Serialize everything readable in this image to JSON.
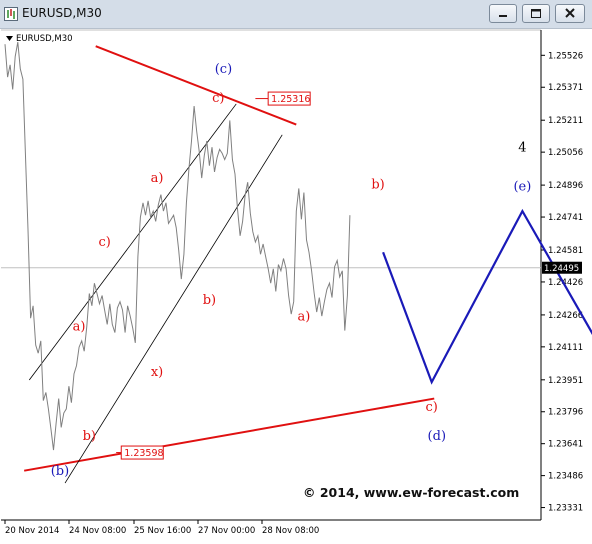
{
  "window": {
    "title": "EURUSD,M30",
    "buttons": [
      "minimize",
      "maximize",
      "close"
    ]
  },
  "colors": {
    "price": "#808080",
    "trendline": "#e01010",
    "channel": "#000000",
    "projection": "#1a1ab8",
    "label_red": "#e01010",
    "label_blue": "#1a1ab8",
    "current_price_bg": "#000000",
    "price_tag": "#e01010"
  },
  "chart_data": {
    "type": "line",
    "symbol_label": "EURUSD,M30",
    "y_ticks": [
      "1.25526",
      "1.25371",
      "1.25211",
      "1.25056",
      "1.24896",
      "1.24741",
      "1.24581",
      "1.24426",
      "1.24266",
      "1.24111",
      "1.23951",
      "1.23796",
      "1.23641",
      "1.23486",
      "1.23331"
    ],
    "y_range": [
      1.2329,
      1.2561
    ],
    "x_ticks": [
      "20 Nov 2014",
      "24 Nov 08:00",
      "25 Nov 16:00",
      "27 Nov 00:00",
      "28 Nov 08:00"
    ],
    "current_price": "1.24495",
    "series": [
      {
        "values": [
          1.2558,
          1.2542,
          1.2548,
          1.2536,
          1.2552,
          1.2559,
          1.2546,
          1.2541,
          1.2505,
          1.2468,
          1.2425,
          1.2431,
          1.2412,
          1.2408,
          1.2414,
          1.2385,
          1.2389,
          1.2381,
          1.2371,
          1.2361,
          1.2374,
          1.2386,
          1.2372,
          1.2379,
          1.2381,
          1.2392,
          1.2384,
          1.2398,
          1.2402,
          1.2411,
          1.2414,
          1.2409,
          1.2421,
          1.2437,
          1.2431,
          1.2442,
          1.2437,
          1.2432,
          1.2436,
          1.2429,
          1.2422,
          1.2432,
          1.2422,
          1.2418,
          1.243,
          1.2433,
          1.2429,
          1.2418,
          1.2431,
          1.2426,
          1.242,
          1.2413,
          1.2455,
          1.2474,
          1.2481,
          1.2475,
          1.2482,
          1.2474,
          1.2477,
          1.2472,
          1.248,
          1.2485,
          1.2477,
          1.2481,
          1.2471,
          1.2473,
          1.2475,
          1.2469,
          1.2458,
          1.2444,
          1.2456,
          1.2481,
          1.2498,
          1.2511,
          1.2528,
          1.2516,
          1.2506,
          1.2493,
          1.2504,
          1.2511,
          1.2499,
          1.2508,
          1.2496,
          1.2503,
          1.2507,
          1.2505,
          1.2502,
          1.2505,
          1.2521,
          1.2502,
          1.2495,
          1.2478,
          1.2465,
          1.2472,
          1.2485,
          1.2491,
          1.2476,
          1.2467,
          1.2462,
          1.2465,
          1.2456,
          1.2461,
          1.2455,
          1.2449,
          1.2442,
          1.2449,
          1.2438,
          1.2451,
          1.2448,
          1.2454,
          1.2449,
          1.2436,
          1.2427,
          1.2433,
          1.2477,
          1.2488,
          1.2473,
          1.2486,
          1.2463,
          1.2457,
          1.2448,
          1.2437,
          1.2428,
          1.2435,
          1.2426,
          1.2433,
          1.2439,
          1.2442,
          1.2435,
          1.245,
          1.2453,
          1.2445,
          1.2448,
          1.2419,
          1.2436,
          1.2475
        ]
      }
    ],
    "trendlines": [
      {
        "color": "red",
        "from": {
          "index": 71,
          "value": 1.2557
        },
        "to": {
          "index": 228,
          "value": 1.2519
        }
      },
      {
        "color": "red",
        "from": {
          "index": 15,
          "value": 1.2351
        },
        "to": {
          "index": 336,
          "value": 1.2386
        }
      },
      {
        "color": "black",
        "from": {
          "index": 19,
          "value": 1.2395
        },
        "to": {
          "index": 181,
          "value": 1.2529
        }
      },
      {
        "color": "black",
        "from": {
          "index": 47,
          "value": 1.2345
        },
        "to": {
          "index": 217,
          "value": 1.2514
        }
      }
    ],
    "price_tags": [
      {
        "text": "1.25316",
        "value": 1.25316,
        "from_index": 196,
        "to_index": 206
      },
      {
        "text": "1.23598",
        "value": 1.23598,
        "from_index": 87,
        "to_index": 91
      }
    ],
    "projection": [
      {
        "index": 296,
        "value": 1.2457
      },
      {
        "index": 334,
        "value": 1.2394
      },
      {
        "index": 405,
        "value": 1.2477
      },
      {
        "index": 464,
        "value": 1.2413
      }
    ],
    "wave_labels": [
      {
        "text": "(c)",
        "color": "blue",
        "index": 171,
        "value": 1.2544
      },
      {
        "text": "c)",
        "color": "red",
        "index": 167,
        "value": 1.253
      },
      {
        "text": "a)",
        "color": "red",
        "index": 119,
        "value": 1.2491
      },
      {
        "text": "c)",
        "color": "red",
        "index": 78,
        "value": 1.246
      },
      {
        "text": "a)",
        "color": "red",
        "index": 58,
        "value": 1.2419
      },
      {
        "text": "b)",
        "color": "red",
        "index": 66,
        "value": 1.2366
      },
      {
        "text": "(b)",
        "color": "blue",
        "index": 43,
        "value": 1.2349
      },
      {
        "text": "x)",
        "color": "red",
        "index": 119,
        "value": 1.2397
      },
      {
        "text": "b)",
        "color": "red",
        "index": 160,
        "value": 1.2432
      },
      {
        "text": "b)",
        "color": "red",
        "index": 292,
        "value": 1.2488
      },
      {
        "text": "a)",
        "color": "red",
        "index": 234,
        "value": 1.2424
      },
      {
        "text": "4",
        "color": "black",
        "index": 405,
        "value": 1.2506
      },
      {
        "text": "(e)",
        "color": "blue",
        "index": 405,
        "value": 1.2487
      },
      {
        "text": "c)",
        "color": "red",
        "index": 334,
        "value": 1.238
      },
      {
        "text": "(d)",
        "color": "blue",
        "index": 338,
        "value": 1.2366
      }
    ]
  },
  "watermark": "© 2014, www.ew-forecast.com"
}
